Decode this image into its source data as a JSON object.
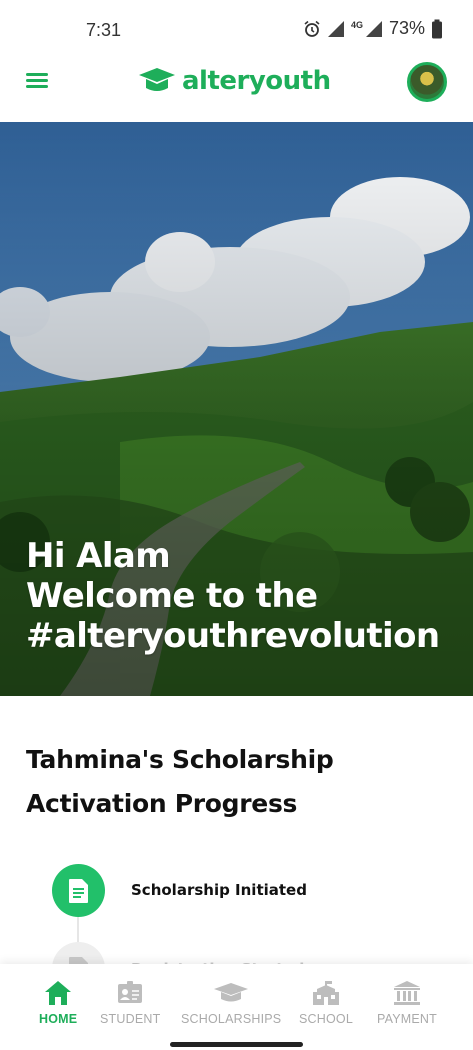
{
  "status_bar": {
    "time": "7:31",
    "network": "4G",
    "battery": "73%"
  },
  "header": {
    "brand": "alteryouth"
  },
  "hero": {
    "line1": "Hi Alam",
    "line2": "Welcome to the",
    "line3": "#alteryouthrevolution"
  },
  "progress": {
    "title_line1": "Tahmina's Scholarship",
    "title_line2": "Activation Progress",
    "steps": [
      {
        "label": "Scholarship Initiated",
        "icon": "document-icon",
        "state": "done"
      },
      {
        "label": "Registration Started",
        "icon": "document-icon",
        "state": "pending"
      }
    ]
  },
  "nav": {
    "items": [
      {
        "label": "HOME",
        "icon": "home-icon",
        "active": true
      },
      {
        "label": "STUDENT",
        "icon": "id-card-icon",
        "active": false
      },
      {
        "label": "SCHOLARSHIPS",
        "icon": "graduation-cap-icon",
        "active": false
      },
      {
        "label": "SCHOOL",
        "icon": "school-icon",
        "active": false
      },
      {
        "label": "PAYMENT",
        "icon": "bank-icon",
        "active": false
      }
    ]
  },
  "colors": {
    "brand_green": "#1eae5a",
    "step_done": "#22c06a",
    "nav_inactive": "#aaaaaa"
  }
}
